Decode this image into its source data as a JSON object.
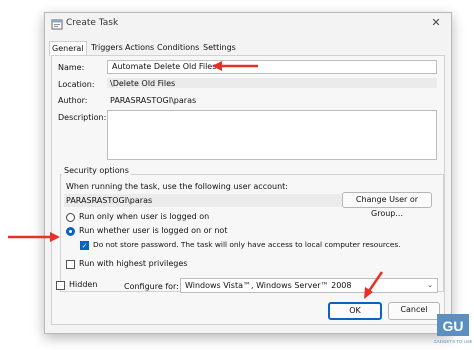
{
  "window": {
    "title": "Create Task",
    "close_glyph": "✕"
  },
  "tabs": [
    "General",
    "Triggers",
    "Actions",
    "Conditions",
    "Settings"
  ],
  "general": {
    "name_label": "Name:",
    "name_value": "Automate Delete Old Files",
    "location_label": "Location:",
    "location_value": "\\Delete Old Files",
    "author_label": "Author:",
    "author_value": "PARASRASTOGI\\paras",
    "description_label": "Description:",
    "description_value": ""
  },
  "security": {
    "group_label": "Security options",
    "account_prompt": "When running the task, use the following user account:",
    "account_value": "PARASRASTOGI\\paras",
    "change_button": "Change User or Group...",
    "radio_logged_on": "Run only when user is logged on",
    "radio_whether": "Run whether user is logged on or not",
    "no_store_password": "Do not store password.  The task will only have access to local computer resources.",
    "highest_privileges": "Run with highest privileges"
  },
  "bottom": {
    "hidden_label": "Hidden",
    "configure_label": "Configure for:",
    "configure_value": "Windows Vista™, Windows Server™ 2008",
    "ok_button": "OK",
    "cancel_button": "Cancel"
  },
  "state": {
    "selected_tab": "General",
    "run_whether_selected": true,
    "do_not_store_password_checked": true,
    "highest_privileges_checked": false,
    "hidden_checked": false
  },
  "colors": {
    "accent": "#0b62c4",
    "annotation_arrow": "#e8302a"
  },
  "watermark": {
    "text_top": "GU",
    "text_bottom": "GADGETS TO USE"
  }
}
